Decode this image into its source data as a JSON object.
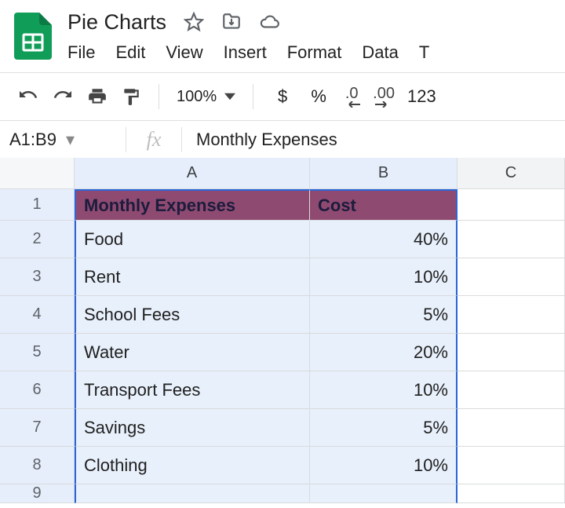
{
  "doc": {
    "title": "Pie Charts"
  },
  "menus": {
    "file": "File",
    "edit": "Edit",
    "view": "View",
    "insert": "Insert",
    "format": "Format",
    "data": "Data",
    "tools_partial": "T"
  },
  "toolbar": {
    "zoom": "100%",
    "currency": "$",
    "percent": "%",
    "dec_decimals": ".0",
    "inc_decimals": ".00",
    "more_formats": "123"
  },
  "fxbar": {
    "cell_ref": "A1:B9",
    "fx": "fx",
    "value": "Monthly Expenses"
  },
  "columns": {
    "A": "A",
    "B": "B",
    "C": "C"
  },
  "rownums": {
    "1": "1",
    "2": "2",
    "3": "3",
    "4": "4",
    "5": "5",
    "6": "6",
    "7": "7",
    "8": "8",
    "9": "9"
  },
  "sheet": {
    "header": {
      "A": "Monthly Expenses",
      "B": "Cost"
    },
    "rows": [
      {
        "category": "Food",
        "cost": "40%"
      },
      {
        "category": "Rent",
        "cost": "10%"
      },
      {
        "category": "School Fees",
        "cost": "5%"
      },
      {
        "category": "Water",
        "cost": "20%"
      },
      {
        "category": "Transport Fees",
        "cost": "10%"
      },
      {
        "category": "Savings",
        "cost": "5%"
      },
      {
        "category": "Clothing",
        "cost": "10%"
      }
    ]
  },
  "chart_data": {
    "type": "table",
    "title": "Monthly Expenses",
    "columns": [
      "Monthly Expenses",
      "Cost"
    ],
    "rows": [
      [
        "Food",
        "40%"
      ],
      [
        "Rent",
        "10%"
      ],
      [
        "School Fees",
        "5%"
      ],
      [
        "Water",
        "20%"
      ],
      [
        "Transport Fees",
        "10%"
      ],
      [
        "Savings",
        "5%"
      ],
      [
        "Clothing",
        "10%"
      ]
    ]
  }
}
